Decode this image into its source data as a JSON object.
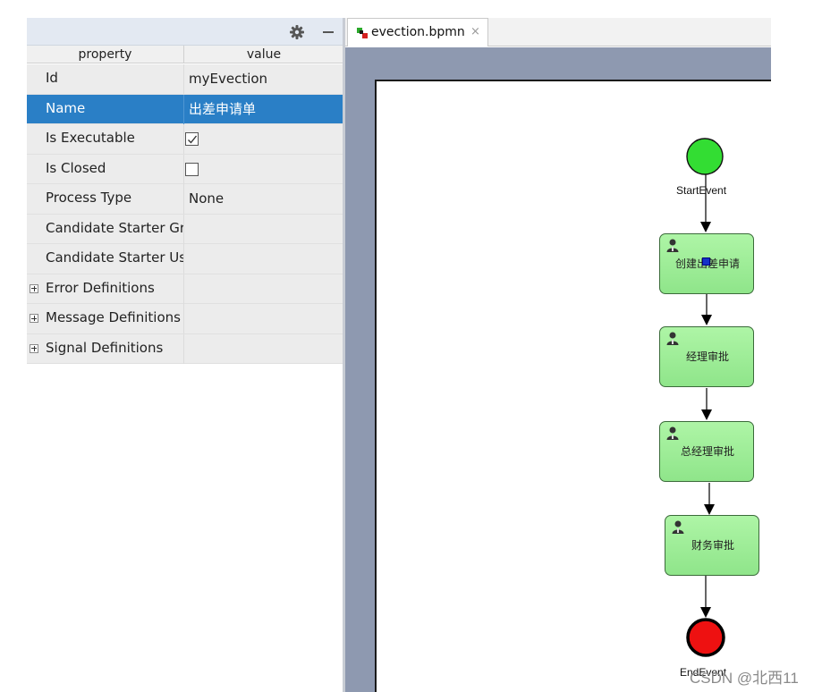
{
  "properties_panel": {
    "toolbar": {
      "settings_icon": "gear-icon",
      "minimize_icon": "minimize-icon"
    },
    "columns": {
      "property": "property",
      "value": "value"
    },
    "rows": [
      {
        "name": "Id",
        "value": "myEvection"
      },
      {
        "name": "Name",
        "value": "出差申请单",
        "selected": true
      },
      {
        "name": "Is Executable",
        "checked": true
      },
      {
        "name": "Is Closed",
        "checked": false
      },
      {
        "name": "Process Type",
        "value": "None"
      },
      {
        "name": "Candidate Starter Groups",
        "value": ""
      },
      {
        "name": "Candidate Starter Users",
        "value": ""
      },
      {
        "name": "Error Definitions",
        "group": true
      },
      {
        "name": "Message Definitions",
        "group": true
      },
      {
        "name": "Signal Definitions",
        "group": true
      }
    ],
    "selected_row_color": "#2a7fc6"
  },
  "editor": {
    "tab": {
      "label": "evection.bpmn",
      "close": "×",
      "icon": "bpmn-file-icon"
    },
    "background_color": "#8e99b0"
  },
  "diagram": {
    "start_event": {
      "label": "StartEvent",
      "color": "#33dd33"
    },
    "tasks": [
      {
        "label": "创建出差申请",
        "icon": "user-icon"
      },
      {
        "label": "经理审批",
        "icon": "user-icon"
      },
      {
        "label": "总经理审批",
        "icon": "user-icon"
      },
      {
        "label": "财务审批",
        "icon": "user-icon"
      }
    ],
    "end_event": {
      "label": "EndEvent",
      "color": "#ee1111"
    },
    "task_color": "#9be995"
  },
  "watermark": "CSDN @北西11"
}
